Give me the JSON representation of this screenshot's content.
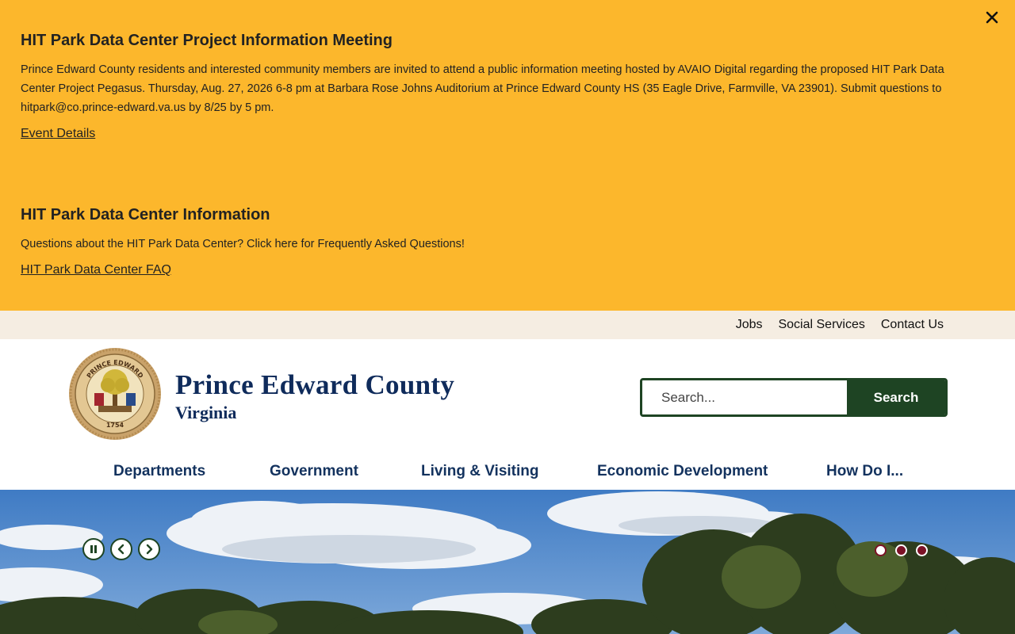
{
  "alerts": [
    {
      "title": "HIT Park Data Center Project Information Meeting",
      "body": "Prince Edward County residents and interested community members are invited to attend a public information meeting hosted by AVAIO Digital regarding the proposed HIT Park Data Center Project Pegasus. Thursday, Aug. 27, 2026 6-8 pm at Barbara Rose Johns Auditorium at Prince Edward County HS (35 Eagle Drive, Farmville, VA 23901). Submit questions to hitpark@co.prince-edward.va.us by 8/25 by 5 pm.",
      "link": "Event Details"
    },
    {
      "title": "HIT Park Data Center Information",
      "body": "Questions about the HIT Park Data Center? Click here for Frequently Asked Questions!",
      "link": "HIT Park Data Center FAQ"
    }
  ],
  "alert_close_icon": "close-icon",
  "utility_links": [
    "Jobs",
    "Social Services",
    "Contact Us"
  ],
  "site": {
    "title": "Prince Edward County",
    "subtitle": "Virginia",
    "seal_text": "COUNTY OF PRINCE EDWARD VIRGINIA",
    "seal_year": "1754"
  },
  "search": {
    "placeholder": "Search...",
    "button_label": "Search"
  },
  "nav": [
    "Departments",
    "Government",
    "Living & Visiting",
    "Economic Development",
    "How Do I..."
  ],
  "slideshow": {
    "controls": [
      "pause-icon",
      "chevron-left-icon",
      "chevron-right-icon"
    ],
    "dots": 3,
    "active_dot": 1
  },
  "colors": {
    "alert_bg": "#fcb72c",
    "utility_bg": "#f5ede2",
    "brand_navy": "#0f2b5b",
    "search_green": "#1e4423",
    "dot_maroon": "#7c1227"
  }
}
